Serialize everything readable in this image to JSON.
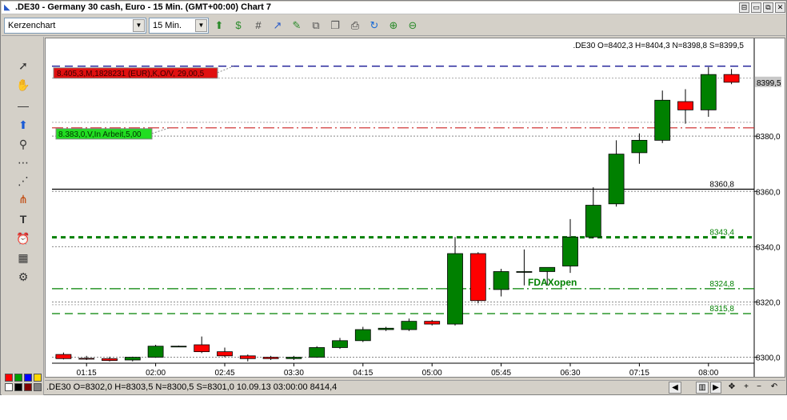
{
  "window": {
    "title": ".DE30 - Germany 30 cash, Euro - 15 Min. (GMT+00:00)   Chart 7",
    "controls": [
      "⊟",
      "▭",
      "⧉",
      "✕"
    ]
  },
  "toolbar": {
    "chart_type_value": "Kerzenchart",
    "timeframe_value": "15 Min.",
    "icons": [
      "add-indicator-icon",
      "refresh-data-icon",
      "grid-icon",
      "trend-icon",
      "draw-icon",
      "properties-icon",
      "copy-icon",
      "print-icon",
      "reload-icon",
      "zoom-in-icon",
      "zoom-out-icon"
    ]
  },
  "left_tools": {
    "tools": [
      "cursor-icon",
      "hand-icon",
      "horizontal-line-icon",
      "arrow-up-icon",
      "zoom-icon",
      "fibonacci-icon",
      "gann-fan-icon",
      "pitchfork-icon",
      "text-icon",
      "alarm-icon",
      "calculator-icon",
      "settings-icon"
    ],
    "palette": [
      "#ff0000",
      "#00a000",
      "#0000ff",
      "#ffd800",
      "#ffffff",
      "#000000",
      "#800000",
      "#808080"
    ]
  },
  "chart": {
    "header_ohlc": ".DE30 O=8402,3 H=8404,3 N=8398,8 S=8399,5",
    "sell_order_label": "8.405,3,M,1828231 (EUR),K,O/V, 29,00,5",
    "buy_order_label": "8.383,0,V,In Arbeit,5,00",
    "fdax_label": "FDAXopen",
    "current_price_label": "8399,5",
    "level_labels": [
      "8360,8",
      "8343,4",
      "8324,8",
      "8315,8"
    ],
    "status_text": ".DE30 O=8302,0 H=8303,5 N=8300,5 S=8301,0   10.09.13 03:00:00 8414,4",
    "colors": {
      "up_candle": "#008000",
      "down_candle": "#ff0000",
      "sell_line": "#00008b",
      "buy_line": "#cc2222",
      "level_green": "#008000",
      "dotted_grey": "#808080"
    }
  },
  "chart_data": {
    "type": "candlestick",
    "symbol": ".DE30",
    "x_ticks": [
      "01:15",
      "02:00",
      "02:45",
      "03:30",
      "04:15",
      "05:00",
      "05:45",
      "06:30",
      "07:15",
      "08:00"
    ],
    "y_ticks": [
      8300,
      8320,
      8340,
      8360,
      8380
    ],
    "y_tick_labels": [
      "8300,0",
      "8320,0",
      "8340,0",
      "8360,0",
      "8380,0"
    ],
    "ylim": [
      8299,
      8409
    ],
    "candles": [
      {
        "o": 8301.0,
        "h": 8301.7,
        "c": 8299.5,
        "l": 8299.2
      },
      {
        "o": 8299.6,
        "h": 8300.5,
        "c": 8299.5,
        "l": 8299.0
      },
      {
        "o": 8299.5,
        "h": 8300.2,
        "c": 8298.8,
        "l": 8298.5
      },
      {
        "o": 8299.0,
        "h": 8300.2,
        "c": 8300.0,
        "l": 8298.5
      },
      {
        "o": 8300.0,
        "h": 8304.5,
        "c": 8304.0,
        "l": 8299.8
      },
      {
        "o": 8304.0,
        "h": 8304.2,
        "c": 8304.0,
        "l": 8303.8
      },
      {
        "o": 8304.5,
        "h": 8307.5,
        "c": 8302.0,
        "l": 8301.5
      },
      {
        "o": 8302.0,
        "h": 8303.5,
        "c": 8300.5,
        "l": 8300.0
      },
      {
        "o": 8300.5,
        "h": 8301.0,
        "c": 8299.5,
        "l": 8298.5
      },
      {
        "o": 8300.0,
        "h": 8300.5,
        "c": 8299.5,
        "l": 8299.0
      },
      {
        "o": 8299.5,
        "h": 8300.5,
        "c": 8300.0,
        "l": 8299.0
      },
      {
        "o": 8300.0,
        "h": 8304.0,
        "c": 8303.5,
        "l": 8299.8
      },
      {
        "o": 8303.5,
        "h": 8307.0,
        "c": 8306.0,
        "l": 8303.0
      },
      {
        "o": 8306.0,
        "h": 8311.0,
        "c": 8310.0,
        "l": 8305.5
      },
      {
        "o": 8310.0,
        "h": 8311.0,
        "c": 8310.5,
        "l": 8309.5
      },
      {
        "o": 8310.0,
        "h": 8314.0,
        "c": 8313.0,
        "l": 8309.5
      },
      {
        "o": 8313.0,
        "h": 8313.5,
        "c": 8312.0,
        "l": 8311.5
      },
      {
        "o": 8312.0,
        "h": 8343.5,
        "c": 8337.5,
        "l": 8311.5
      },
      {
        "o": 8337.5,
        "h": 8338.0,
        "c": 8320.5,
        "l": 8319.5
      },
      {
        "o": 8324.5,
        "h": 8332.0,
        "c": 8331.0,
        "l": 8322.0
      },
      {
        "o": 8331.0,
        "h": 8339.0,
        "c": 8331.0,
        "l": 8326.0
      },
      {
        "o": 8331.0,
        "h": 8332.5,
        "c": 8332.5,
        "l": 8326.0
      },
      {
        "o": 8333.0,
        "h": 8350.0,
        "c": 8343.5,
        "l": 8330.5
      },
      {
        "o": 8343.5,
        "h": 8361.5,
        "c": 8355.0,
        "l": 8343.0
      },
      {
        "o": 8355.5,
        "h": 8378.5,
        "c": 8373.5,
        "l": 8354.5
      },
      {
        "o": 8374.0,
        "h": 8381.0,
        "c": 8378.5,
        "l": 8370.0
      },
      {
        "o": 8378.5,
        "h": 8396.5,
        "c": 8393.0,
        "l": 8377.5
      },
      {
        "o": 8392.5,
        "h": 8397.0,
        "c": 8389.5,
        "l": 8384.5
      },
      {
        "o": 8389.5,
        "h": 8405.0,
        "c": 8402.3,
        "l": 8387.0
      },
      {
        "o": 8402.3,
        "h": 8404.3,
        "c": 8399.5,
        "l": 8398.8
      }
    ],
    "horizontal_lines": [
      {
        "label": "8405,3",
        "value": 8405.3,
        "style": "dashed",
        "color": "#00008b"
      },
      {
        "label": "8383,0",
        "value": 8383.0,
        "style": "dashdot",
        "color": "#cc2222"
      },
      {
        "label": "8360,8",
        "value": 8360.8,
        "style": "solid",
        "color": "#000000"
      },
      {
        "label": "8343,4",
        "value": 8343.4,
        "style": "thick-dashed",
        "color": "#008000"
      },
      {
        "label": "8324,8",
        "value": 8324.8,
        "style": "dashdot",
        "color": "#008000"
      },
      {
        "label": "8315,8",
        "value": 8315.8,
        "style": "dashed",
        "color": "#008000"
      }
    ]
  }
}
